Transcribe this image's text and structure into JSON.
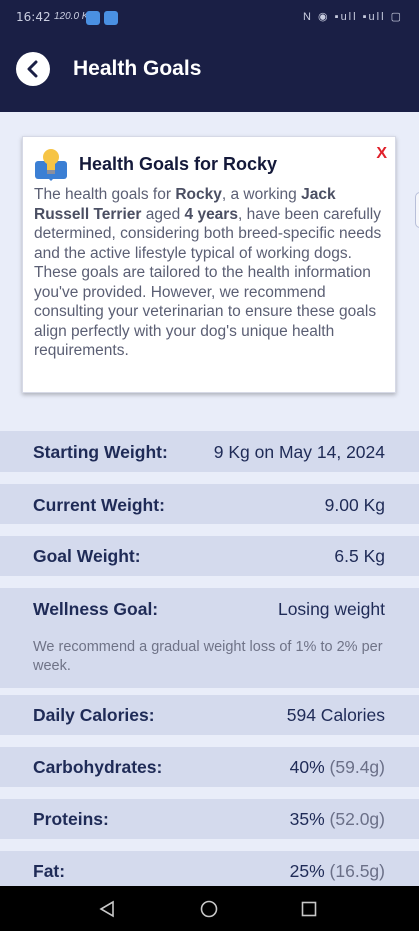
{
  "status_bar": {
    "time": "16:42",
    "speed": "120.0 K/s",
    "right_icons": "N ◉ ▪ull ▪ull ▢"
  },
  "app_bar": {
    "title": "Health Goals",
    "back_icon": "chevron-left-icon"
  },
  "info_card": {
    "title": "Health Goals for Rocky",
    "close_label": "X",
    "icon": "lightbulb-icon",
    "body_parts": {
      "p1": "The health goals for ",
      "dog_name": "Rocky",
      "p2": ", a working ",
      "breed": "Jack Russell Terrier",
      "p3": " aged ",
      "age": "4 years",
      "p4": ", have been carefully determined, considering both breed-specific needs and the active lifestyle typical of working dogs. These goals are tailored to the health information you've provided. However, we recommend consulting your veterinarian to ensure these goals align perfectly with your dog's unique health requirements."
    }
  },
  "metrics": {
    "starting_weight": {
      "label": "Starting Weight:",
      "value": "9 Kg on May 14, 2024"
    },
    "current_weight": {
      "label": "Current Weight:",
      "value": "9.00 Kg"
    },
    "goal_weight": {
      "label": "Goal Weight:",
      "value": "6.5 Kg"
    },
    "wellness_goal": {
      "label": "Wellness Goal:",
      "value": "Losing weight",
      "note": "We recommend a gradual weight loss of 1% to 2% per week."
    },
    "daily_calories": {
      "label": "Daily Calories:",
      "value": "594 Calories"
    },
    "carbohydrates": {
      "label": "Carbohydrates:",
      "percent": "40%",
      "grams": "(59.4g)"
    },
    "proteins": {
      "label": "Proteins:",
      "percent": "35%",
      "grams": "(52.0g)"
    },
    "fat": {
      "label": "Fat:",
      "percent": "25%",
      "grams": "(16.5g)"
    }
  },
  "nav_bar": {
    "back_icon": "triangle-back-icon",
    "home_icon": "circle-home-icon",
    "recents_icon": "square-recents-icon"
  },
  "colors": {
    "header_bg": "#1a1f45",
    "page_bg": "#e9edf9",
    "row_bg": "#d4daed",
    "text_primary": "#1f2b57",
    "close_red": "#e0202a"
  }
}
